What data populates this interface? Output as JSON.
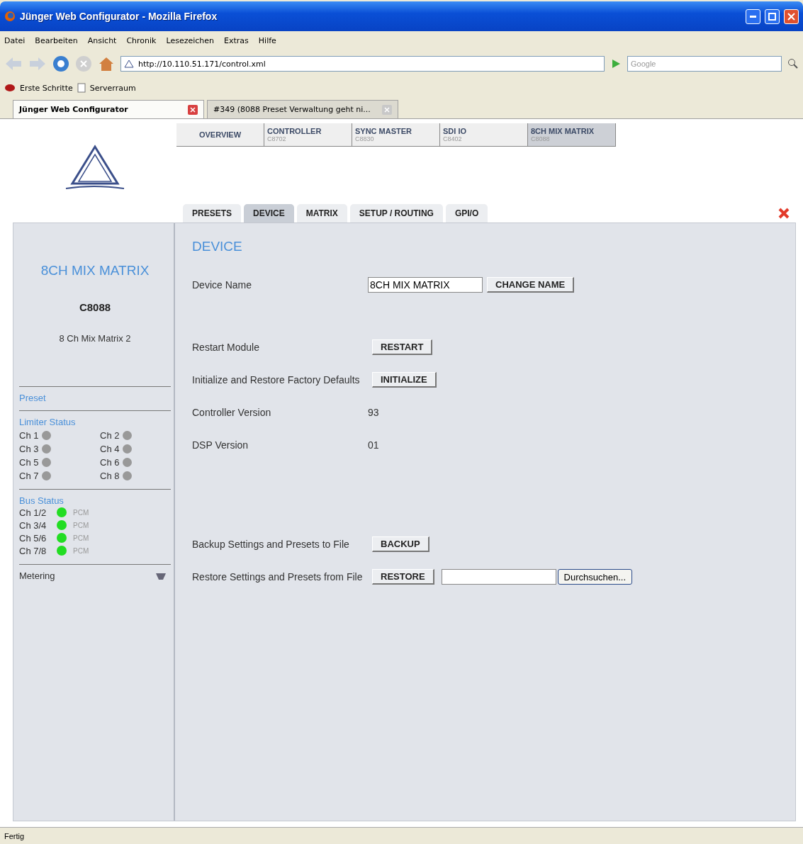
{
  "window": {
    "title": "Jünger Web Configurator - Mozilla Firefox"
  },
  "menu": [
    "Datei",
    "Bearbeiten",
    "Ansicht",
    "Chronik",
    "Lesezeichen",
    "Extras",
    "Hilfe"
  ],
  "address_bar": {
    "value": "http://10.110.51.171/control.xml"
  },
  "search": {
    "placeholder": "Google"
  },
  "bookmarks": [
    "Erste Schritte",
    "Serverraum"
  ],
  "browser_tabs": [
    {
      "label": "Jünger Web Configurator",
      "selected": true
    },
    {
      "label": "#349 (8088 Preset Verwaltung geht ni...",
      "selected": false
    }
  ],
  "module_tabs": [
    {
      "name": "OVERVIEW",
      "selected": false
    },
    {
      "name": "CONTROLLER",
      "code": "C8702",
      "selected": false
    },
    {
      "name": "SYNC MASTER",
      "code": "C8830",
      "selected": false
    },
    {
      "name": "SDI IO",
      "code": "C8402",
      "selected": false
    },
    {
      "name": "8CH MIX MATRIX",
      "code": "C8088",
      "selected": true
    }
  ],
  "page_tabs": [
    {
      "label": "PRESETS",
      "selected": false
    },
    {
      "label": "DEVICE",
      "selected": true
    },
    {
      "label": "MATRIX",
      "selected": false
    },
    {
      "label": "SETUP / ROUTING",
      "selected": false
    },
    {
      "label": "GPI/O",
      "selected": false
    }
  ],
  "sidebar": {
    "title": "8CH MIX MATRIX",
    "model": "C8088",
    "description": "8 Ch Mix Matrix 2",
    "preset_heading": "Preset",
    "limiter": {
      "heading": "Limiter Status",
      "channels": [
        {
          "label": "Ch 1",
          "color": "#999999"
        },
        {
          "label": "Ch 2",
          "color": "#999999"
        },
        {
          "label": "Ch 3",
          "color": "#999999"
        },
        {
          "label": "Ch 4",
          "color": "#999999"
        },
        {
          "label": "Ch 5",
          "color": "#999999"
        },
        {
          "label": "Ch 6",
          "color": "#999999"
        },
        {
          "label": "Ch 7",
          "color": "#999999"
        },
        {
          "label": "Ch 8",
          "color": "#999999"
        }
      ]
    },
    "bus": {
      "heading": "Bus Status",
      "channels": [
        {
          "label": "Ch 1/2",
          "color": "#22dd22",
          "format": "PCM"
        },
        {
          "label": "Ch 3/4",
          "color": "#22dd22",
          "format": "PCM"
        },
        {
          "label": "Ch 5/6",
          "color": "#22dd22",
          "format": "PCM"
        },
        {
          "label": "Ch 7/8",
          "color": "#22dd22",
          "format": "PCM"
        }
      ]
    },
    "metering": "Metering"
  },
  "device": {
    "heading": "DEVICE",
    "groups": [
      [
        {
          "kind": "field",
          "label": "Device Name",
          "value": "8CH MIX MATRIX",
          "button": "CHANGE NAME"
        }
      ],
      [
        {
          "kind": "button",
          "label": "Restart Module",
          "button": "RESTART"
        },
        {
          "kind": "button",
          "label": "Initialize and Restore Factory Defaults",
          "button": "INITIALIZE"
        },
        {
          "kind": "value",
          "label": "Controller Version",
          "value": "93"
        },
        {
          "kind": "value",
          "label": "DSP Version",
          "value": "01"
        }
      ],
      [
        {
          "kind": "button",
          "label": "Backup Settings and Presets to File",
          "button": "BACKUP"
        },
        {
          "kind": "file",
          "label": "Restore Settings and Presets from File",
          "button": "RESTORE",
          "browse": "Durchsuchen..."
        }
      ]
    ]
  },
  "status_bar": "Fertig"
}
